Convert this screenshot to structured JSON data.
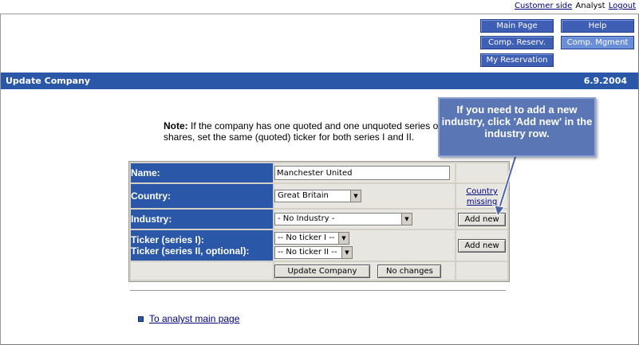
{
  "top_links": {
    "customer_side": "Customer side",
    "analyst": "Analyst",
    "logout": "Logout"
  },
  "nav": {
    "main_page": "Main Page",
    "help": "Help",
    "comp_reserv": "Comp. Reserv.",
    "comp_mgment": "Comp. Mgment",
    "my_reservation": "My Reservation"
  },
  "titlebar": {
    "title": "Update Company",
    "date": "6.9.2004"
  },
  "note": {
    "bold": "Note:",
    "text": " If the company has one quoted and one unquoted series of shares, set the same (quoted) ticker for both series I and II."
  },
  "form": {
    "name_label": "Name:",
    "name_value": "Manchester United",
    "country_label": "Country:",
    "country_value": "Great Britain",
    "country_missing": "Country missing",
    "industry_label": "Industry:",
    "industry_value": "- No Industry -",
    "industry_add": "Add new",
    "ticker_label_1": "Ticker (series I):",
    "ticker_label_2": "Ticker (series II, optional):",
    "ticker1_value": "-- No ticker I --",
    "ticker2_value": "-- No ticker II --",
    "ticker_add": "Add new",
    "update_button": "Update Company",
    "no_changes_button": "No changes"
  },
  "bottom_link": "To analyst main page",
  "callout": {
    "text": "If you need to add a new industry, click 'Add new' in the industry row."
  },
  "colors": {
    "accent": "#2a57a8",
    "callout": "#5a76b4"
  }
}
